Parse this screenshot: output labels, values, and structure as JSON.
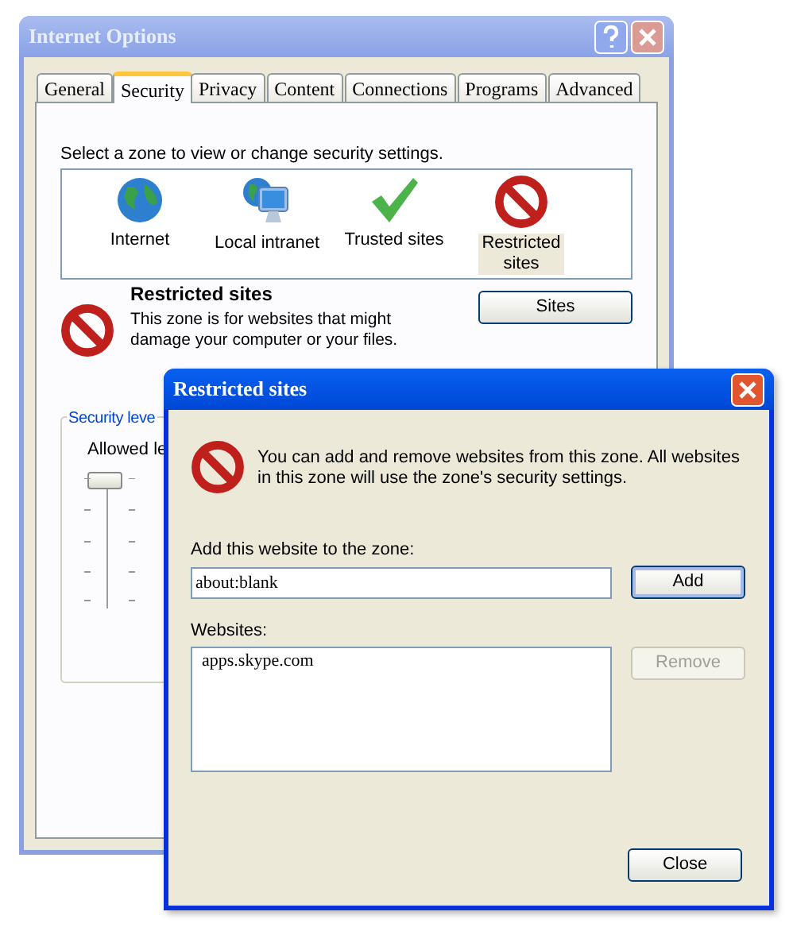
{
  "main_window": {
    "title": "Internet Options"
  },
  "tabs": [
    {
      "label": "General",
      "selected": false
    },
    {
      "label": "Security",
      "selected": true
    },
    {
      "label": "Privacy",
      "selected": false
    },
    {
      "label": "Content",
      "selected": false
    },
    {
      "label": "Connections",
      "selected": false
    },
    {
      "label": "Programs",
      "selected": false
    },
    {
      "label": "Advanced",
      "selected": false
    }
  ],
  "zone_prompt": "Select a zone to view or change security settings.",
  "zones": [
    {
      "kind": "internet",
      "label": "Internet",
      "selected": false
    },
    {
      "kind": "intranet",
      "label": "Local intranet",
      "selected": false
    },
    {
      "kind": "trusted",
      "label": "Trusted sites",
      "selected": false
    },
    {
      "kind": "restricted",
      "label": "Restricted sites",
      "selected": true
    }
  ],
  "zone_info": {
    "heading": "Restricted sites",
    "description": "This zone is for websites that might damage your computer or your files.",
    "button": "Sites"
  },
  "security_level": {
    "group_label": "Security leve",
    "allowed_label": "Allowed le",
    "slider": {
      "level": 1
    }
  },
  "dialog": {
    "title": "Restricted sites",
    "message": "You can add and remove websites from this zone. All websites in this zone will use the zone's security settings.",
    "add_label": "Add this website to the zone:",
    "website_value": "about:blank",
    "add_button": {
      "label": "Add",
      "disabled": false
    },
    "websites_label": "Websites:",
    "websites": [
      "apps.skype.com"
    ],
    "remove_button": {
      "label": "Remove",
      "disabled": true
    },
    "close_button": {
      "label": "Close",
      "disabled": false
    }
  }
}
